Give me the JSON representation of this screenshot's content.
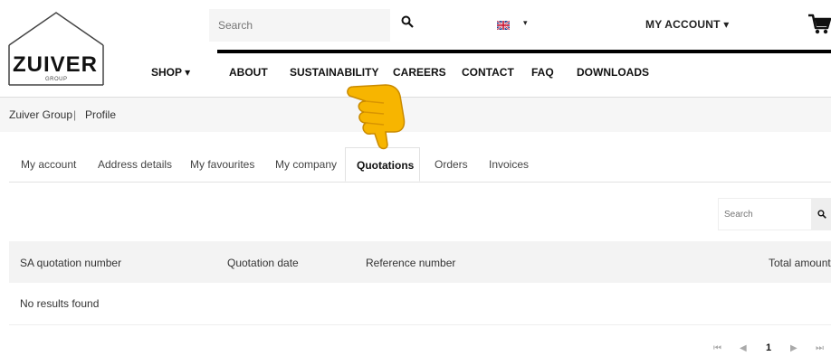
{
  "header": {
    "logo_text": "ZUIVER",
    "logo_sub": "GROUP",
    "search_placeholder": "Search",
    "account_label": "MY ACCOUNT ▾",
    "lang_caret": "▾"
  },
  "nav": {
    "items": [
      "SHOP ▾",
      "ABOUT",
      "SUSTAINABILITY",
      "CAREERS",
      "CONTACT",
      "FAQ",
      "DOWNLOADS"
    ]
  },
  "breadcrumb": {
    "items": [
      "Zuiver Group",
      "Profile"
    ],
    "separator": "|"
  },
  "tabs": {
    "items": [
      "My account",
      "Address details",
      "My favourites",
      "My company",
      "Quotations",
      "Orders",
      "Invoices"
    ],
    "active": "Quotations"
  },
  "table_search": {
    "placeholder": "Search"
  },
  "table": {
    "columns": [
      "SA quotation number",
      "Quotation date",
      "Reference number",
      "Total amount"
    ],
    "empty_message": "No results found"
  },
  "pagination": {
    "first": "⏮",
    "prev": "◀",
    "current": "1",
    "next": "▶",
    "last": "⏭"
  },
  "colors": {
    "accent": "#000000",
    "header_bg": "#ffffff",
    "table_head_bg": "#f3f3f3",
    "hand": "#f7b500"
  }
}
